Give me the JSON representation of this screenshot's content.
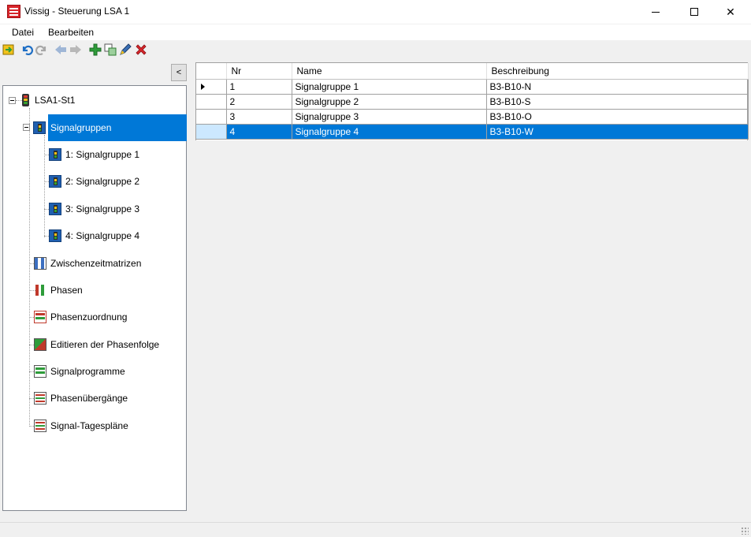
{
  "window": {
    "title": "Vissig - Steuerung LSA 1"
  },
  "menu": {
    "items": [
      {
        "label": "Datei"
      },
      {
        "label": "Bearbeiten"
      }
    ]
  },
  "toolbar": {
    "icons": [
      "import-icon",
      "undo-icon",
      "redo-icon",
      "back-icon",
      "forward-icon",
      "add-icon",
      "copy-icon",
      "edit-icon",
      "delete-icon"
    ],
    "colors": {
      "undo": "#1f6fc5",
      "add": "#2e9c3a",
      "delete": "#d8262b",
      "edit": "#3a6fb5"
    }
  },
  "sidebar": {
    "collapse_label": "<",
    "root": {
      "label": "LSA1-St1"
    },
    "items": [
      {
        "label": "Signalgruppen",
        "selected": true
      },
      {
        "label": "1: Signalgruppe 1"
      },
      {
        "label": "2: Signalgruppe 2"
      },
      {
        "label": "3: Signalgruppe 3"
      },
      {
        "label": "4: Signalgruppe 4"
      },
      {
        "label": "Zwischenzeitmatrizen"
      },
      {
        "label": "Phasen"
      },
      {
        "label": "Phasenzuordnung"
      },
      {
        "label": "Editieren der Phasenfolge"
      },
      {
        "label": "Signalprogramme"
      },
      {
        "label": "Phasenübergänge"
      },
      {
        "label": "Signal-Tagespläne"
      }
    ]
  },
  "grid": {
    "columns": [
      "Nr",
      "Name",
      "Beschreibung"
    ],
    "rows": [
      {
        "nr": "1",
        "name": "Signalgruppe 1",
        "beschreibung": "B3-B10-N",
        "current": true
      },
      {
        "nr": "2",
        "name": "Signalgruppe 2",
        "beschreibung": "B3-B10-S"
      },
      {
        "nr": "3",
        "name": "Signalgruppe 3",
        "beschreibung": "B3-B10-O"
      },
      {
        "nr": "4",
        "name": "Signalgruppe 4",
        "beschreibung": "B3-B10-W",
        "selected": true
      }
    ],
    "selection_color": "#0078d7"
  }
}
